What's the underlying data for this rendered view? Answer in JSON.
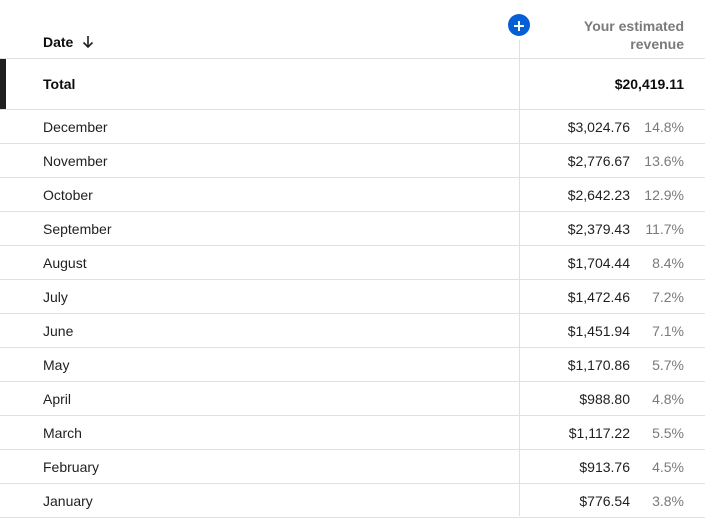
{
  "header": {
    "date_label": "Date",
    "sort_icon": "arrow-down-icon",
    "add_icon": "plus-icon",
    "revenue_label_line1": "Your estimated",
    "revenue_label_line2": "revenue"
  },
  "total": {
    "label": "Total",
    "value": "$20,419.11"
  },
  "rows": [
    {
      "month": "December",
      "revenue": "$3,024.76",
      "percent": "14.8%"
    },
    {
      "month": "November",
      "revenue": "$2,776.67",
      "percent": "13.6%"
    },
    {
      "month": "October",
      "revenue": "$2,642.23",
      "percent": "12.9%"
    },
    {
      "month": "September",
      "revenue": "$2,379.43",
      "percent": "11.7%"
    },
    {
      "month": "August",
      "revenue": "$1,704.44",
      "percent": "8.4%"
    },
    {
      "month": "July",
      "revenue": "$1,472.46",
      "percent": "7.2%"
    },
    {
      "month": "June",
      "revenue": "$1,451.94",
      "percent": "7.1%"
    },
    {
      "month": "May",
      "revenue": "$1,170.86",
      "percent": "5.7%"
    },
    {
      "month": "April",
      "revenue": "$988.80",
      "percent": "4.8%"
    },
    {
      "month": "March",
      "revenue": "$1,117.22",
      "percent": "5.5%"
    },
    {
      "month": "February",
      "revenue": "$913.76",
      "percent": "4.5%"
    },
    {
      "month": "January",
      "revenue": "$776.54",
      "percent": "3.8%"
    }
  ],
  "colors": {
    "accent": "#065fd4",
    "muted_text": "#7a7a7a",
    "divider": "#e0e0e0",
    "total_bar": "#1f1f1f"
  }
}
